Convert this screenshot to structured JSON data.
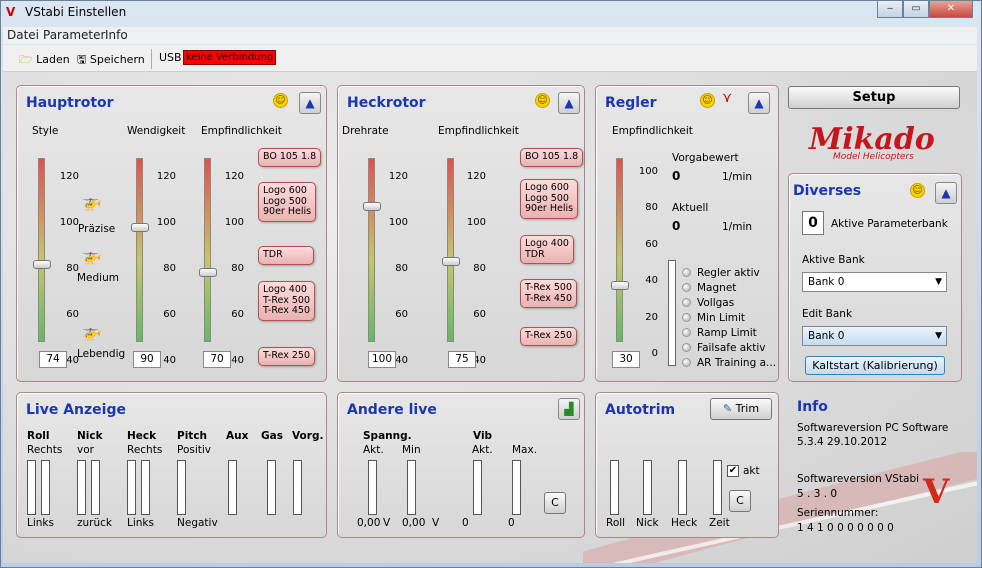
{
  "window": {
    "title": "VStabi Einstellen"
  },
  "menu": [
    "Datei",
    "Parameter",
    "Info"
  ],
  "toolbar": {
    "load": "Laden",
    "save": "Speichern",
    "port": "USB",
    "status": "keine Verbindung"
  },
  "hauptrotor": {
    "title": "Hauptrotor",
    "col_style": "Style",
    "col_wendigkeit": "Wendigkeit",
    "col_empf": "Empfindlichkeit",
    "ticks": [
      "120",
      "100",
      "80",
      "60",
      "40"
    ],
    "heli_labels": [
      "Präzise",
      "Medium",
      "Lebendig"
    ],
    "style_value": "74",
    "wendigkeit_value": "90",
    "empf_value": "70",
    "style_level": 74,
    "wendigkeit_level": 90,
    "empf_level": 70,
    "callouts": [
      "BO 105 1.8",
      "Logo 600\nLogo 500\n90er Helis",
      "TDR",
      "Logo 400\nT-Rex 500\nT-Rex 450",
      "T-Rex 250"
    ]
  },
  "heckrotor": {
    "title": "Heckrotor",
    "col_drehrate": "Drehrate",
    "col_empf": "Empfindlichkeit",
    "ticks": [
      "120",
      "100",
      "80",
      "60",
      "40"
    ],
    "drehrate_value": "100",
    "empf_value": "75",
    "drehrate_level": 100,
    "empf_level": 75,
    "callouts": [
      "BO 105 1.8",
      "Logo 600\nLogo 500\n90er Helis",
      "Logo 400\nTDR",
      "T-Rex 500\nT-Rex 450",
      "T-Rex 250"
    ]
  },
  "regler": {
    "title": "Regler",
    "col_empf": "Empfindlichkeit",
    "ticks": [
      "100",
      "80",
      "60",
      "40",
      "20",
      "0"
    ],
    "empf_value": "30",
    "empf_level": 30,
    "vorgabewert_label": "Vorgabewert",
    "vorgabewert": "0",
    "unit1": "1/min",
    "aktuell_label": "Aktuell",
    "aktuell": "0",
    "unit2": "1/min",
    "status_items": [
      "Regler aktiv",
      "Magnet",
      "Vollgas",
      "Min Limit",
      "Ramp Limit",
      "Failsafe aktiv",
      "AR Training a..."
    ]
  },
  "setup": {
    "label": "Setup"
  },
  "logo": {
    "name": "Mikado",
    "sub": "Model Helicopters"
  },
  "diverses": {
    "title": "Diverses",
    "param_bank_value": "0",
    "param_bank_label": "Aktive Parameterbank",
    "aktive_bank_label": "Aktive Bank",
    "aktive_bank_value": "Bank 0",
    "edit_bank_label": "Edit Bank",
    "edit_bank_value": "Bank 0",
    "kaltstart": "Kaltstart (Kalibrierung)"
  },
  "live": {
    "title": "Live Anzeige",
    "cols": [
      {
        "name": "Roll",
        "top": "Rechts",
        "bottom": "Links"
      },
      {
        "name": "Nick",
        "top": "vor",
        "bottom": "zurück"
      },
      {
        "name": "Heck",
        "top": "Rechts",
        "bottom": "Links"
      },
      {
        "name": "Pitch",
        "top": "Positiv",
        "bottom": "Negativ"
      },
      {
        "name": "Aux",
        "top": "",
        "bottom": ""
      },
      {
        "name": "Gas",
        "top": "",
        "bottom": ""
      },
      {
        "name": "Vorg.",
        "top": "",
        "bottom": ""
      }
    ]
  },
  "andere": {
    "title": "Andere live",
    "spannung": "Spanng.",
    "vib": "Vib",
    "akt": "Akt.",
    "min": "Min",
    "akt2": "Akt.",
    "max": "Max.",
    "v_akt": "0,00",
    "v_min": "0,00",
    "unit_v1": "V",
    "unit_v2": "V",
    "vib_akt": "0",
    "vib_max": "0",
    "c_label": "C"
  },
  "autotrim": {
    "title": "Autotrim",
    "trim_label": "Trim",
    "akt_label": "akt",
    "akt_checked": true,
    "c_label": "C",
    "bars": [
      "Roll",
      "Nick",
      "Heck",
      "Zeit"
    ]
  },
  "info": {
    "title": "Info",
    "pc_sw_label": "Softwareversion PC Software",
    "pc_sw_value": "5.3.4  29.10.2012",
    "vstabi_sw_label": "Softwareversion VStabi",
    "vstabi_sw_value": "5 . 3 . 0",
    "serial_label": "Seriennummer:",
    "serial_value": "1 4 1 0 0 0 0 0 0 0"
  },
  "colors": {
    "title_blue": "#1c35b0",
    "status_red": "#ff0000",
    "callout_pink": "#f3c6c6"
  }
}
